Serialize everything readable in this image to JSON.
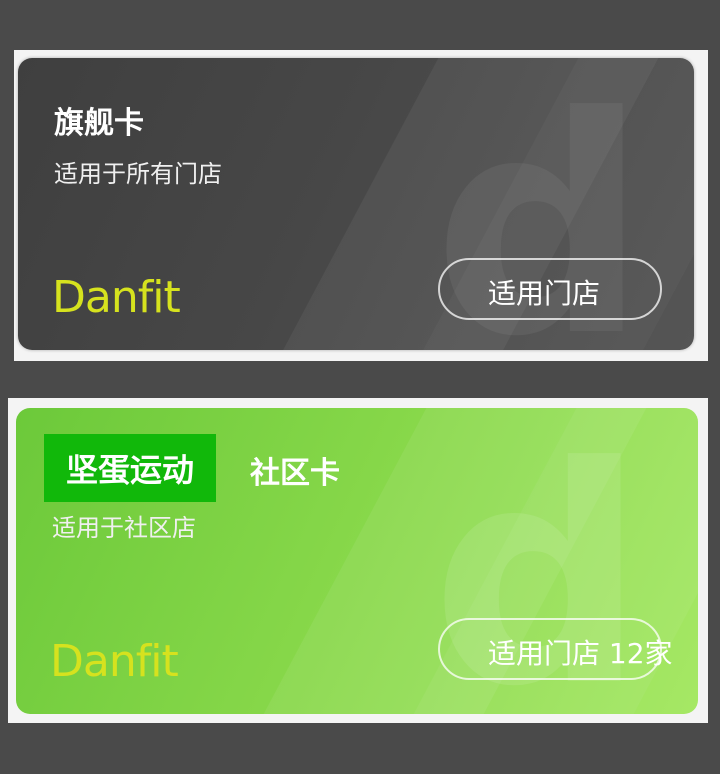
{
  "cards": [
    {
      "title": "旗舰卡",
      "subtitle": "适用于所有门店",
      "brand": "Danfit",
      "button_label": "适用门店"
    },
    {
      "tag": "坚蛋运动",
      "title": "社区卡",
      "subtitle": "适用于社区店",
      "brand": "Danfit",
      "button_label": "适用门店 12家"
    }
  ],
  "colors": {
    "background": "#4a4a4a",
    "card1": "#444444",
    "card2": "#88d84a",
    "brand": "#d6e21e",
    "tag": "#11b80a"
  }
}
